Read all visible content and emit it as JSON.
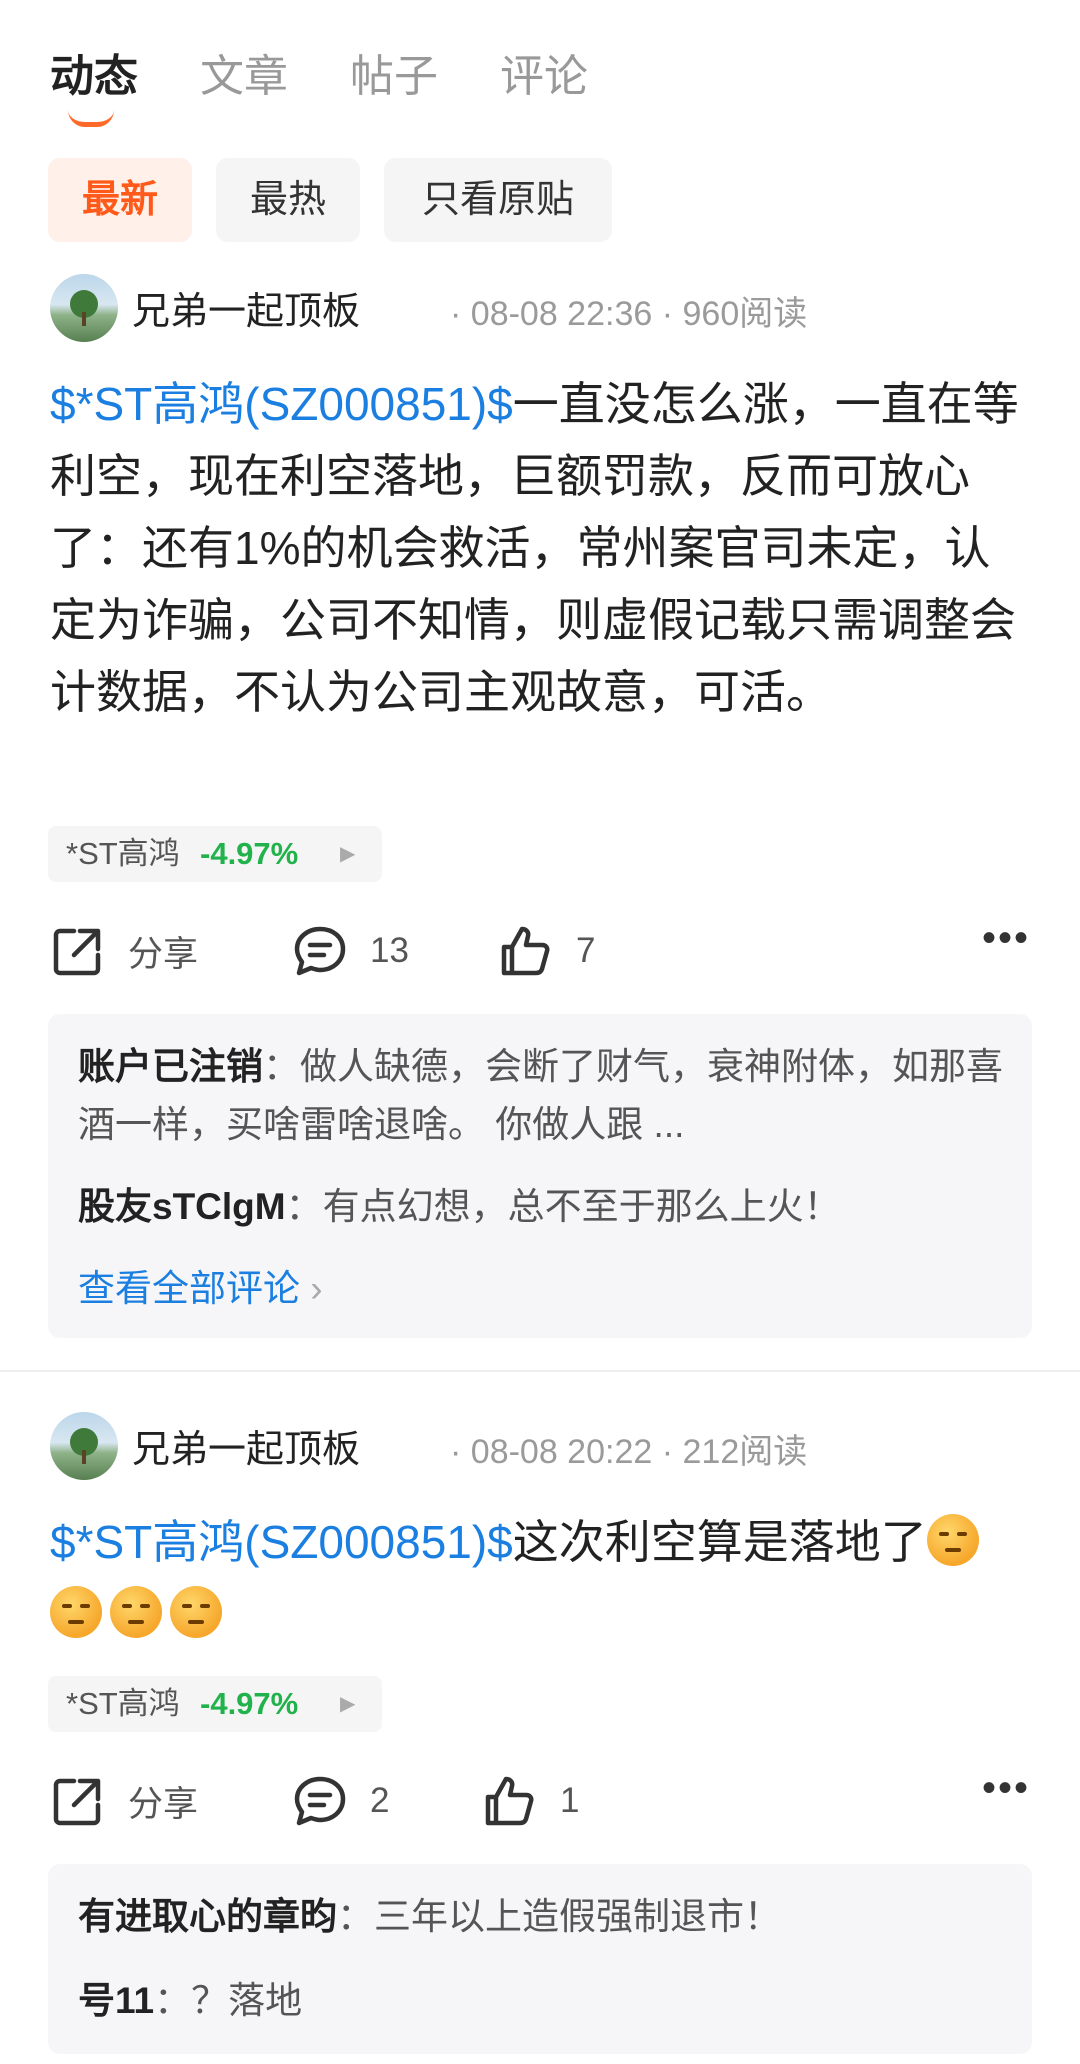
{
  "tabs": [
    "动态",
    "文章",
    "帖子",
    "评论"
  ],
  "filters": [
    "最新",
    "最热",
    "只看原贴"
  ],
  "posts": [
    {
      "author": "兄弟一起顶板",
      "time": "08-08 22:36",
      "reads": "960阅读",
      "tag": "$*ST高鸿(SZ000851)$",
      "text": "一直没怎么涨，一直在等利空，现在利空落地，巨额罚款，反而可放心了：还有1%的机会救活，常州案官司未定，认定为诈骗，公司不知情，则虚假记载只需调整会计数据，不认为公司主观故意，可活。",
      "stock": {
        "name": "*ST高鸿",
        "change": "-4.97%"
      },
      "actions": {
        "share": "分享",
        "comments": "13",
        "likes": "7"
      },
      "comments": [
        {
          "user": "账户已注销",
          "text": "做人缺德，会断了财气，衰神附体，如那喜酒一样，买啥雷啥退啥。 你做人跟 ..."
        },
        {
          "user": "股友sTClgM",
          "text": "有点幻想，总不至于那么上火！"
        }
      ],
      "view_all": "查看全部评论"
    },
    {
      "author": "兄弟一起顶板",
      "time": "08-08 20:22",
      "reads": "212阅读",
      "tag": "$*ST高鸿(SZ000851)$",
      "text": "这次利空算是落地了",
      "stock": {
        "name": "*ST高鸿",
        "change": "-4.97%"
      },
      "actions": {
        "share": "分享",
        "comments": "2",
        "likes": "1"
      },
      "comments": [
        {
          "user": "有进取心的章昀",
          "text": "三年以上造假强制退市！"
        },
        {
          "user": "号11",
          "text": "？落地"
        }
      ]
    }
  ],
  "colors": {
    "accent": "#ff5a1a",
    "link": "#1a7fe0",
    "up_down": "#22b24c"
  },
  "icons": [
    "share-icon",
    "comment-icon",
    "like-icon",
    "more-icon",
    "chevron-right-icon"
  ]
}
